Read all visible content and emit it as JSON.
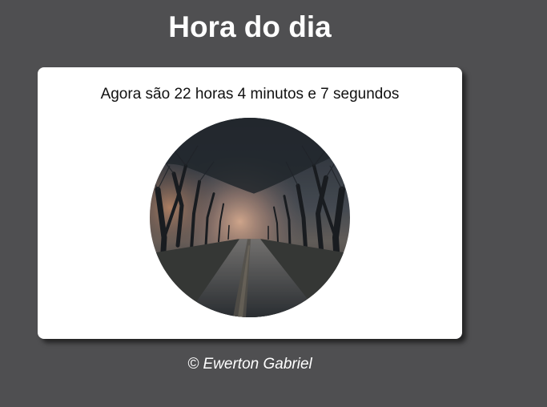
{
  "page": {
    "title": "Hora do dia",
    "footer": "© Ewerton Gabriel"
  },
  "card": {
    "message": "Agora são 22 horas 4 minutos e 7 segundos",
    "image": {
      "subject": "night-foggy-tree-lined-path"
    }
  },
  "colors": {
    "background": "#4f4f51",
    "card": "#ffffff",
    "title_text": "#ffffff"
  }
}
